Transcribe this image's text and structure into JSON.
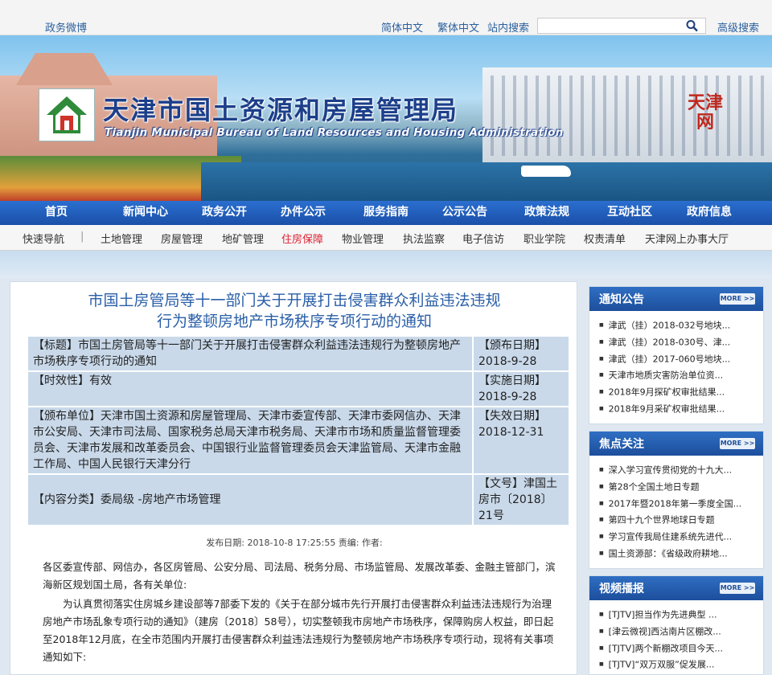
{
  "topbar": {
    "weibo": "政务微博",
    "simplified": "简体中文",
    "traditional": "繁体中文",
    "site_search": "站内搜索",
    "advanced_search": "高级搜索"
  },
  "banner": {
    "title": "天津市国土资源和房屋管理局",
    "subtitle": "Tianjin Municipal Bureau of Land Resources and Housing Administration",
    "stamp": "天津网"
  },
  "nav": [
    "首页",
    "新闻中心",
    "政务公开",
    "办件公示",
    "服务指南",
    "公示公告",
    "政策法规",
    "互动社区",
    "政府信息"
  ],
  "quick": {
    "label": "快速导航",
    "items": [
      "土地管理",
      "房屋管理",
      "地矿管理",
      "住房保障",
      "物业管理",
      "执法监察",
      "电子信访",
      "职业学院",
      "权责清单",
      "天津网上办事大厅"
    ],
    "active": "住房保障"
  },
  "article": {
    "title_line1": "市国土房管局等十一部门关于开展打击侵害群众利益违法违规",
    "title_line2": "行为整顿房地产市场秩序专项行动的通知",
    "meta": [
      {
        "left": "【标题】市国土房管局等十一部门关于开展打击侵害群众利益违法违规行为整顿房地产市场秩序专项行动的通知",
        "right": "【颁布日期】2018-9-28"
      },
      {
        "left": "【时效性】有效",
        "right": "【实施日期】2018-9-28"
      },
      {
        "left": "【颁布单位】天津市国土资源和房屋管理局、天津市委宣传部、天津市委网信办、天津市公安局、天津市司法局、国家税务总局天津市税务局、天津市市场和质量监督管理委员会、天津市发展和改革委员会、中国银行业监督管理委员会天津监管局、天津市金融工作局、中国人民银行天津分行",
        "right": "【失效日期】2018-12-31"
      },
      {
        "left": "【内容分类】委局级 -房地产市场管理",
        "right": "【文号】津国土房市〔2018〕21号"
      }
    ],
    "pub_info": "发布日期: 2018-10-8 17:25:55 责编:    作者:",
    "para1": "各区委宣传部、网信办，各区房管局、公安分局、司法局、税务分局、市场监管局、发展改革委、金融主管部门，滨海新区规划国土局，各有关单位:",
    "para2": "为认真贯彻落实住房城乡建设部等7部委下发的《关于在部分城市先行开展打击侵害群众利益违法违规行为治理房地产市场乱象专项行动的通知》（建房〔2018〕58号），切实整顿我市房地产市场秩序，保障购房人权益，即日起至2018年12月底，在全市范围内开展打击侵害群众利益违法违规行为整顿房地产市场秩序专项行动，现将有关事项通知如下:"
  },
  "sidebar": [
    {
      "title": "通知公告",
      "more": "MORE >>",
      "items": [
        "津武（挂）2018-032号地块...",
        "津武（挂）2018-030号、津...",
        "津武（挂）2017-060号地块...",
        "天津市地质灾害防治单位资...",
        "2018年9月探矿权审批结果...",
        "2018年9月采矿权审批结果..."
      ]
    },
    {
      "title": "焦点关注",
      "more": "MORE >>",
      "items": [
        "深入学习宣传贯彻党的十九大...",
        "第28个全国土地日专题",
        "2017年暨2018年第一季度全国...",
        "第四十九个世界地球日专题",
        "学习宣传我局住建系统先进代...",
        "国土资源部：《省级政府耕地..."
      ]
    },
    {
      "title": "视频播报",
      "more": "MORE >>",
      "items": [
        "[TJTV]担当作为先进典型 ...",
        "[津云微视]西沽南片区棚改...",
        "[TJTV]两个新棚改项目今天...",
        "[TJTV]“双万双服”促发展..."
      ]
    }
  ]
}
